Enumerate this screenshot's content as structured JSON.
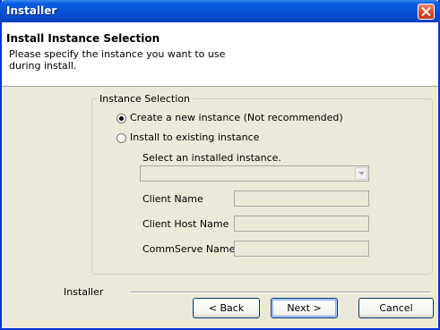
{
  "window": {
    "title": "Installer"
  },
  "header": {
    "title": "Install Instance Selection",
    "subtitle": "Please specify the instance you want to use during install."
  },
  "instance_selection": {
    "legend": "Instance Selection",
    "options": [
      {
        "label": "Create a new instance (Not recommended)",
        "selected": true
      },
      {
        "label": "Install to existing  instance",
        "selected": false
      }
    ],
    "select_label": "Select an installed instance.",
    "select_value": "",
    "fields": {
      "client_name_label": "Client Name",
      "client_name_value": "",
      "client_host_label": "Client Host Name",
      "client_host_value": "",
      "commserve_label": "CommServe Name",
      "commserve_value": ""
    }
  },
  "footer": {
    "label": "Installer",
    "back": "< Back",
    "next": "Next >",
    "cancel": "Cancel"
  },
  "colors": {
    "titlebar": "#0453d8",
    "dialog_bg": "#ece9d8",
    "close_button": "#d9532e"
  },
  "icons": {
    "close": "close-icon",
    "dropdown": "chevron-down-icon"
  }
}
